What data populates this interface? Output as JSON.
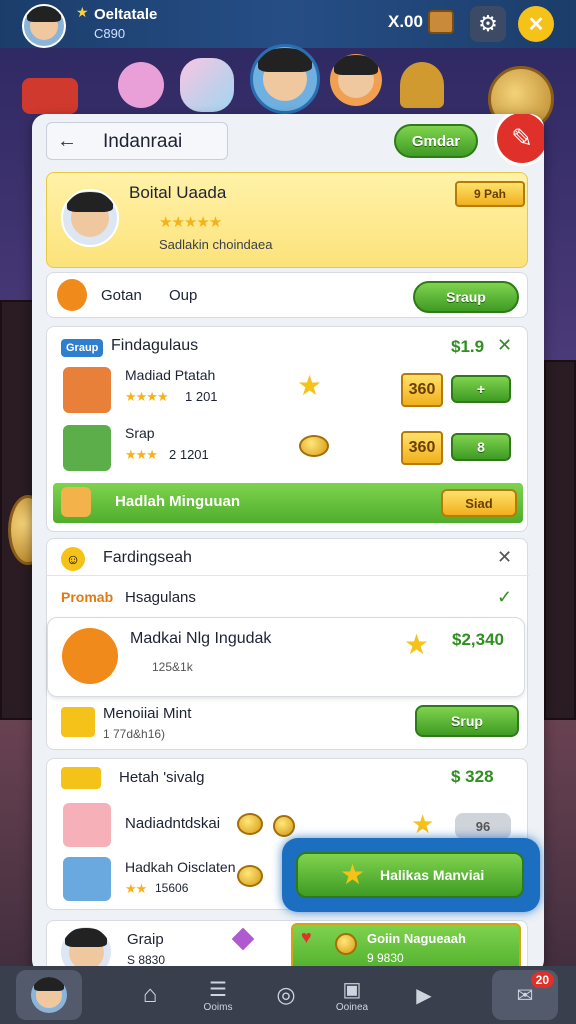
{
  "header": {
    "player_name": "Oeltatale",
    "player_sub": "C890",
    "currency": "X.00"
  },
  "search": {
    "value": "Indanraai"
  },
  "top_button": "Gmdar",
  "profile": {
    "name": "Boital Uaada",
    "badge": "9 Pah",
    "stars": "★★★★★",
    "subtitle": "Sadlakin choindaea"
  },
  "group_row": {
    "label_a": "Gotan",
    "label_b": "Oup",
    "button": "Sraup"
  },
  "section1": {
    "tag": "Graup",
    "title": "Findagulaus",
    "amount": "$1.9",
    "items": [
      {
        "name": "Madiad Ptatah",
        "stars": "★★★★",
        "rating": "1 201",
        "price": "360",
        "btn": "+"
      },
      {
        "name": "Srap",
        "stars": "★★★",
        "rating": "2 1201",
        "price": "360",
        "btn": "8"
      }
    ],
    "banner": "Hadlah Minguuan",
    "banner_btn": "Siad"
  },
  "section2": {
    "title": "Fardingseah",
    "promo": "Promab",
    "promo_title": "Hsagulans",
    "feature": {
      "title": "Madkai Nlg Ingudak",
      "sub": "125&1k",
      "amount": "$2,340"
    },
    "item": {
      "title": "Menoiiai Mint",
      "sub": "1 77d&h16)",
      "btn": "Srup"
    }
  },
  "section3": {
    "title": "Hetah 'sivalg",
    "amount": "$ 328",
    "items": [
      {
        "title": "Nadiadntdskai",
        "btn": "96"
      },
      {
        "title": "Hadkah Oisclaten",
        "stars": "★★",
        "sub": "15606"
      }
    ],
    "cta": "Halikas Manviai"
  },
  "section4": {
    "title": "Graip",
    "sub": "S 8830",
    "cta_title": "Goiin Nagueaah",
    "cta_sub": "9 9830"
  },
  "nav": {
    "items": [
      "",
      "",
      "Ooims",
      "",
      "Ooinea",
      "",
      ""
    ],
    "badge": "20"
  }
}
